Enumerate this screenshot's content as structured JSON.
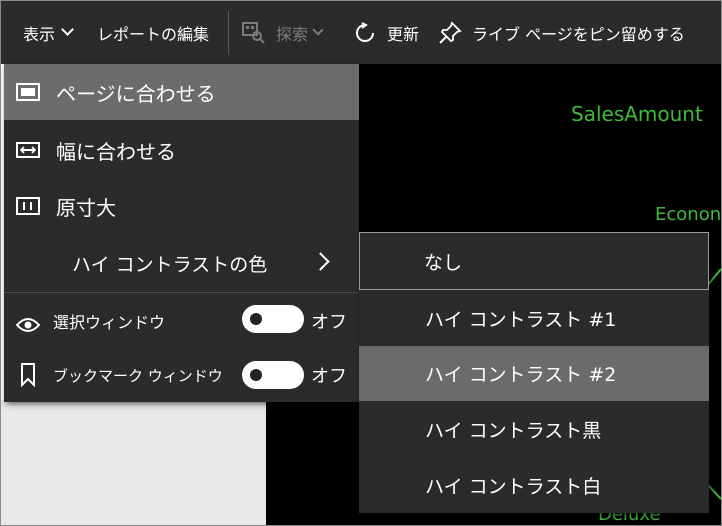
{
  "toolbar": {
    "view_label": "表示",
    "edit_report_label": "レポートの編集",
    "explore_label": "探索",
    "refresh_label": "更新",
    "pin_live_page_label": "ライブ ページをピン留めする"
  },
  "view_menu": {
    "items": [
      {
        "label": "ページに合わせる",
        "icon": "fit-page-icon",
        "selected": true
      },
      {
        "label": "幅に合わせる",
        "icon": "fit-width-icon",
        "selected": false
      },
      {
        "label": "原寸大",
        "icon": "actual-size-icon",
        "selected": false
      },
      {
        "label": "ハイ コントラストの色",
        "icon": "chevron-right-icon",
        "selected": false
      }
    ],
    "selection_pane": {
      "label": "選択ウィンドウ",
      "icon": "eye-icon",
      "state": "オフ"
    },
    "bookmarks_pane": {
      "label": "ブックマーク ウィンドウ",
      "icon": "bookmark-icon",
      "state": "オフ"
    }
  },
  "high_contrast_submenu": {
    "items": [
      {
        "label": "なし",
        "focused": true
      },
      {
        "label": "ハイ コントラスト #1"
      },
      {
        "label": "ハイ コントラスト #2",
        "hovered": true
      },
      {
        "label": "ハイ コントラスト黒"
      },
      {
        "label": "ハイ コントラスト白"
      }
    ]
  },
  "report_canvas": {
    "labels": [
      "SalesAmount",
      "Econon",
      "Deluxe"
    ],
    "text_color": "#3dbb3d",
    "background": "#000000"
  }
}
